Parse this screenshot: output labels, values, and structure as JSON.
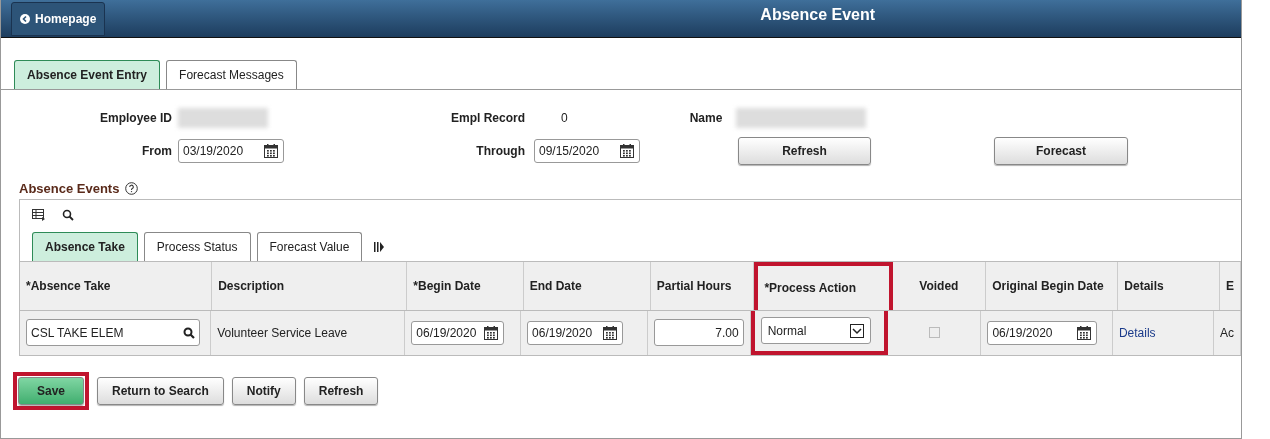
{
  "header": {
    "back_button": "Homepage",
    "title": "Absence Event"
  },
  "tabs": [
    {
      "label": "Absence Event Entry",
      "selected": true
    },
    {
      "label": "Forecast Messages",
      "selected": false
    }
  ],
  "fields": {
    "employee_id_label": "Employee ID",
    "empl_record_label": "Empl Record",
    "empl_record_value": "0",
    "name_label": "Name",
    "from_label": "From",
    "from_value": "03/19/2020",
    "through_label": "Through",
    "through_value": "09/15/2020"
  },
  "action_buttons": [
    "Refresh",
    "Forecast"
  ],
  "grid": {
    "title": "Absence Events",
    "tabs": [
      {
        "label": "Absence Take",
        "selected": true
      },
      {
        "label": "Process Status",
        "selected": false
      },
      {
        "label": "Forecast Value",
        "selected": false
      }
    ],
    "columns": [
      {
        "label": "*Absence Take",
        "highlighted": false
      },
      {
        "label": "Description",
        "highlighted": false
      },
      {
        "label": "*Begin Date",
        "highlighted": false
      },
      {
        "label": "End Date",
        "highlighted": false
      },
      {
        "label": "Partial Hours",
        "highlighted": false
      },
      {
        "label": "*Process Action",
        "highlighted": true
      },
      {
        "label": "Voided",
        "highlighted": false
      },
      {
        "label": "Original Begin Date",
        "highlighted": false
      },
      {
        "label": "Details",
        "highlighted": false
      },
      {
        "label": "E",
        "highlighted": false
      }
    ],
    "rows": [
      {
        "absence_take": "CSL TAKE ELEM",
        "description": "Volunteer Service Leave",
        "begin_date": "06/19/2020",
        "end_date": "06/19/2020",
        "partial_hours": "7.00",
        "process_action": "Normal",
        "voided": false,
        "original_begin_date": "06/19/2020",
        "details": "Details",
        "column_10": "Ac"
      }
    ]
  },
  "footer_buttons": [
    {
      "label": "Save",
      "highlighted": true
    },
    {
      "label": "Return to Search",
      "highlighted": false
    },
    {
      "label": "Notify",
      "highlighted": false
    },
    {
      "label": "Refresh",
      "highlighted": false
    }
  ]
}
